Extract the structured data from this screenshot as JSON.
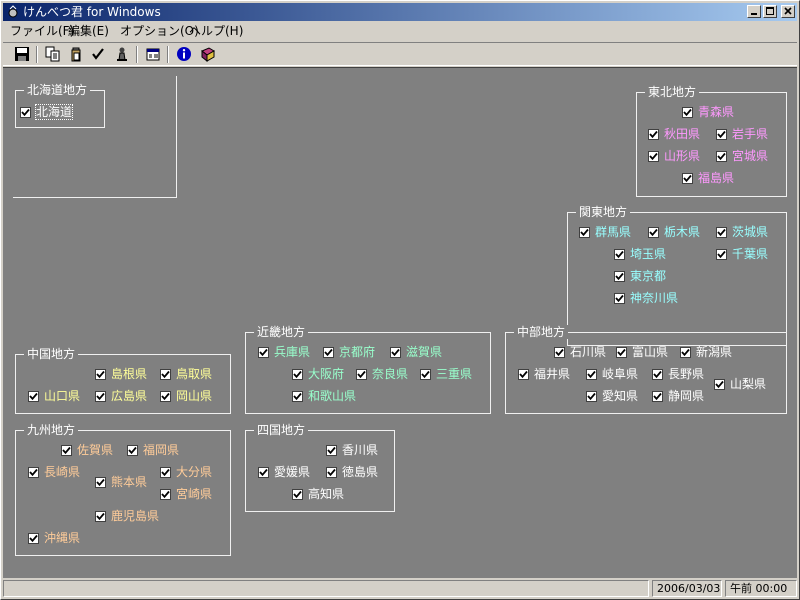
{
  "window": {
    "title": "けんべつ君 for Windows",
    "buttons": [
      "minimize",
      "maximize",
      "close"
    ]
  },
  "menu": [
    "ファイル(F)",
    "編集(E)",
    "オプション(O)",
    "ヘルプ(H)"
  ],
  "toolbar": [
    "save-icon",
    "copy-icon",
    "paste-icon",
    "check-icon",
    "chess-piece-icon",
    "properties-icon",
    "info-icon",
    "help-book-icon"
  ],
  "colors": {
    "hokkaido": "#ffffff",
    "tohoku": "#ff99ff",
    "kanto": "#99ffff",
    "chubu": "#ffffff",
    "kinki": "#99ffcc",
    "chugoku": "#ffff99",
    "kyushu": "#ffcc99",
    "shikoku": "#ffffff"
  },
  "regions": {
    "hokkaido": {
      "title": "北海道地方",
      "prefectures": [
        {
          "name": "北海道",
          "checked": true
        }
      ]
    },
    "tohoku": {
      "title": "東北地方",
      "prefectures": [
        {
          "name": "青森県",
          "checked": true
        },
        {
          "name": "秋田県",
          "checked": true
        },
        {
          "name": "岩手県",
          "checked": true
        },
        {
          "name": "山形県",
          "checked": true
        },
        {
          "name": "宮城県",
          "checked": true
        },
        {
          "name": "福島県",
          "checked": true
        }
      ]
    },
    "kanto": {
      "title": "関東地方",
      "prefectures": [
        {
          "name": "群馬県",
          "checked": true
        },
        {
          "name": "栃木県",
          "checked": true
        },
        {
          "name": "茨城県",
          "checked": true
        },
        {
          "name": "埼玉県",
          "checked": true
        },
        {
          "name": "千葉県",
          "checked": true
        },
        {
          "name": "東京都",
          "checked": true
        },
        {
          "name": "神奈川県",
          "checked": true
        }
      ]
    },
    "chugoku": {
      "title": "中国地方",
      "prefectures": [
        {
          "name": "島根県",
          "checked": true
        },
        {
          "name": "鳥取県",
          "checked": true
        },
        {
          "name": "山口県",
          "checked": true
        },
        {
          "name": "広島県",
          "checked": true
        },
        {
          "name": "岡山県",
          "checked": true
        }
      ]
    },
    "kinki": {
      "title": "近畿地方",
      "prefectures": [
        {
          "name": "兵庫県",
          "checked": true
        },
        {
          "name": "京都府",
          "checked": true
        },
        {
          "name": "滋賀県",
          "checked": true
        },
        {
          "name": "大阪府",
          "checked": true
        },
        {
          "name": "奈良県",
          "checked": true
        },
        {
          "name": "三重県",
          "checked": true
        },
        {
          "name": "和歌山県",
          "checked": true
        }
      ]
    },
    "chubu": {
      "title": "中部地方",
      "prefectures": [
        {
          "name": "石川県",
          "checked": true
        },
        {
          "name": "富山県",
          "checked": true
        },
        {
          "name": "新潟県",
          "checked": true
        },
        {
          "name": "福井県",
          "checked": true
        },
        {
          "name": "岐阜県",
          "checked": true
        },
        {
          "name": "長野県",
          "checked": true
        },
        {
          "name": "山梨県",
          "checked": true
        },
        {
          "name": "愛知県",
          "checked": true
        },
        {
          "name": "静岡県",
          "checked": true
        }
      ]
    },
    "kyushu": {
      "title": "九州地方",
      "prefectures": [
        {
          "name": "佐賀県",
          "checked": true
        },
        {
          "name": "福岡県",
          "checked": true
        },
        {
          "name": "長崎県",
          "checked": true
        },
        {
          "name": "熊本県",
          "checked": true
        },
        {
          "name": "大分県",
          "checked": true
        },
        {
          "name": "宮崎県",
          "checked": true
        },
        {
          "name": "鹿児島県",
          "checked": true
        },
        {
          "name": "沖縄県",
          "checked": true
        }
      ]
    },
    "shikoku": {
      "title": "四国地方",
      "prefectures": [
        {
          "name": "香川県",
          "checked": true
        },
        {
          "name": "愛媛県",
          "checked": true
        },
        {
          "name": "徳島県",
          "checked": true
        },
        {
          "name": "高知県",
          "checked": true
        }
      ]
    }
  },
  "status": {
    "message": "",
    "date": "2006/03/03",
    "time": "午前 00:00"
  }
}
